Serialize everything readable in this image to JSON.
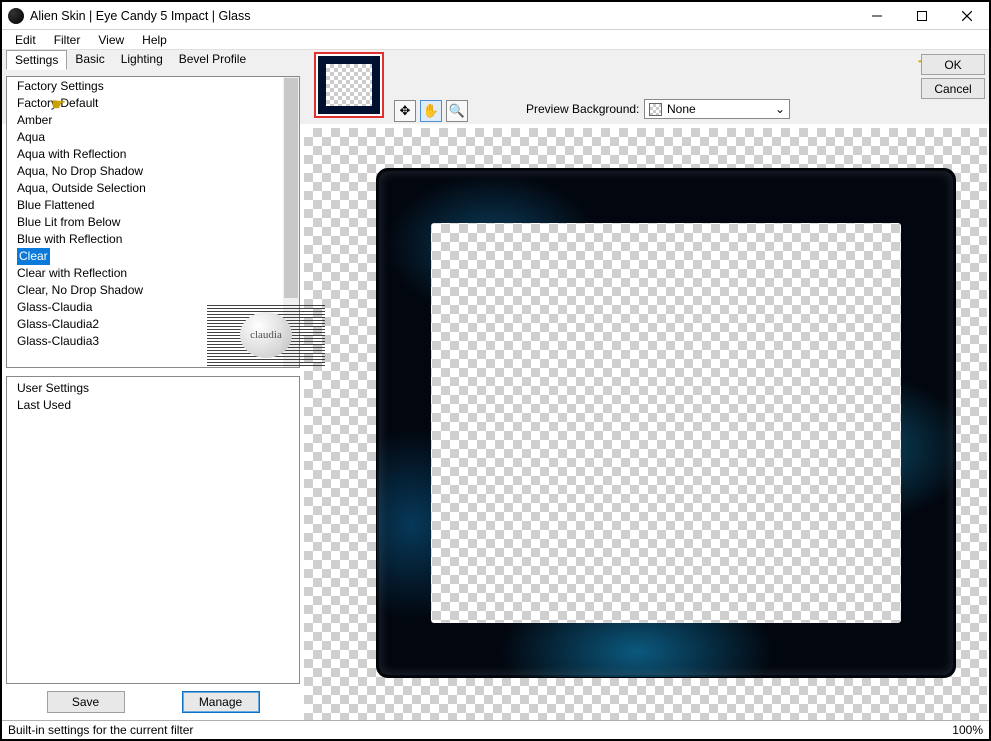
{
  "window": {
    "title": "Alien Skin | Eye Candy 5 Impact | Glass"
  },
  "menu": {
    "items": [
      "Edit",
      "Filter",
      "View",
      "Help"
    ]
  },
  "tabs": {
    "items": [
      "Settings",
      "Basic",
      "Lighting",
      "Bevel Profile"
    ],
    "active_index": 0
  },
  "toolbar": {
    "preview_bg_label": "Preview Background:",
    "preview_bg_value": "None",
    "ok": "OK",
    "cancel": "Cancel"
  },
  "factory": {
    "header": "Factory Settings",
    "items": [
      "Factory Default",
      "Amber",
      "Aqua",
      "Aqua with Reflection",
      "Aqua, No Drop Shadow",
      "Aqua, Outside Selection",
      "Blue Flattened",
      "Blue Lit from Below",
      "Blue with Reflection",
      "Clear",
      "Clear with Reflection",
      "Clear, No Drop Shadow",
      "Glass-Claudia",
      "Glass-Claudia2",
      "Glass-Claudia3"
    ],
    "selected_index": 9
  },
  "user": {
    "header": "User Settings",
    "items": [
      "Last Used"
    ]
  },
  "buttons": {
    "save": "Save",
    "manage": "Manage"
  },
  "watermark": {
    "text": "claudia"
  },
  "status": {
    "message": "Built-in settings for the current filter",
    "zoom": "100%"
  }
}
